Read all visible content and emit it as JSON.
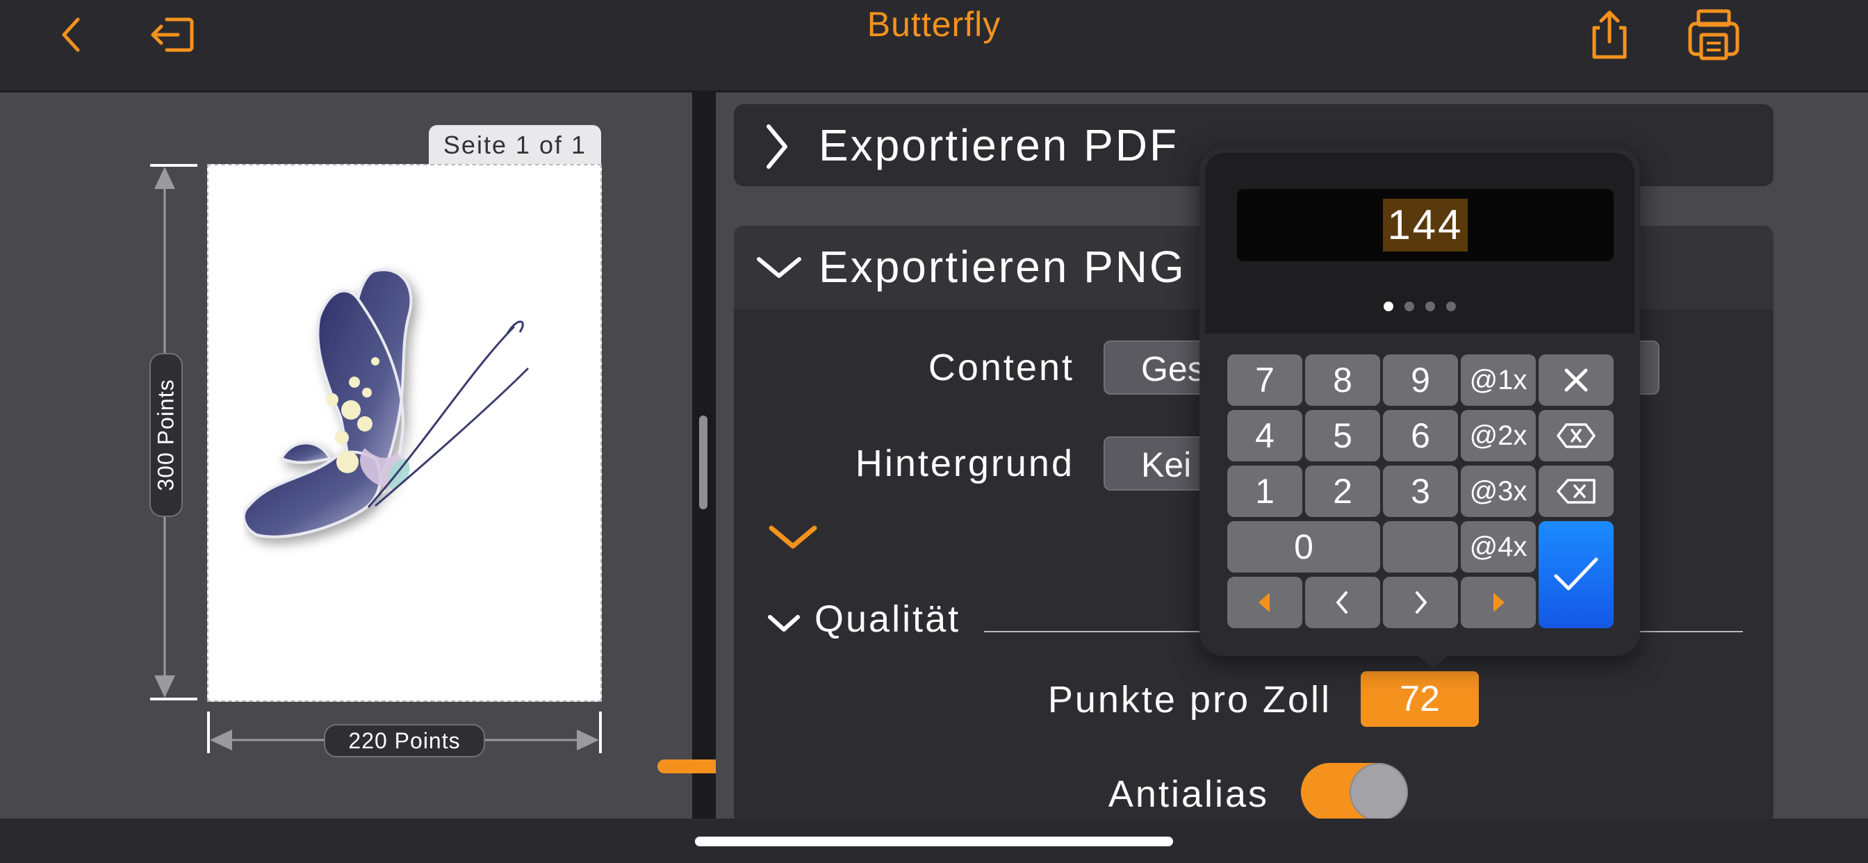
{
  "header": {
    "title": "Butterfly",
    "icons": [
      "back-chevron-icon",
      "exit-icon",
      "share-icon",
      "print-icon"
    ],
    "accent": "#f5921e"
  },
  "preview": {
    "page_indicator": "Seite 1 of 1",
    "height_label": "300 Points",
    "width_label": "220 Points"
  },
  "export": {
    "pdf_title": "Exportieren PDF",
    "png_title": "Exportieren PNG",
    "content_label": "Content",
    "content_value": "Ges",
    "background_label": "Hintergrund",
    "background_value": "Kei",
    "quality_title": "Qualität",
    "dpi_label": "Punkte pro Zoll",
    "dpi_value": "72",
    "antialias_label": "Antialias",
    "antialias_on": true
  },
  "keypad": {
    "display_value": "144",
    "page_dots": 4,
    "active_page": 1,
    "digits": [
      "7",
      "8",
      "9",
      "4",
      "5",
      "6",
      "1",
      "2",
      "3",
      "0"
    ],
    "scale_keys": [
      "@1x",
      "@2x",
      "@3x",
      "@4x"
    ],
    "accent_blue": "#1c8bff"
  }
}
